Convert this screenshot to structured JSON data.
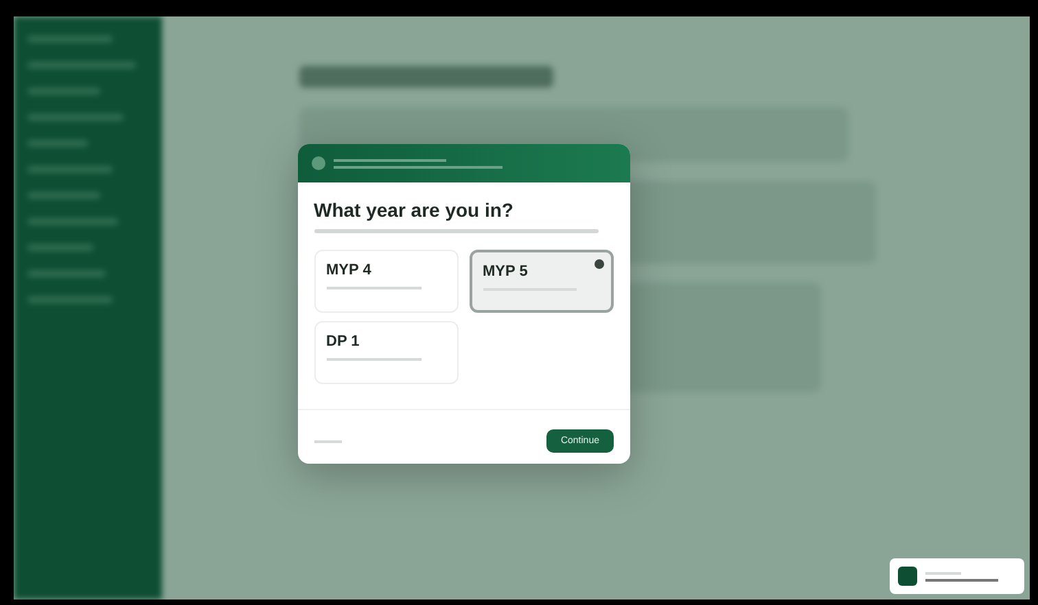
{
  "dialog": {
    "title": "What year are you in?",
    "options": [
      {
        "label": "MYP 4",
        "selected": false
      },
      {
        "label": "MYP 5",
        "selected": true
      },
      {
        "label": "DP 1",
        "selected": false
      }
    ],
    "continue_button": "Continue"
  }
}
